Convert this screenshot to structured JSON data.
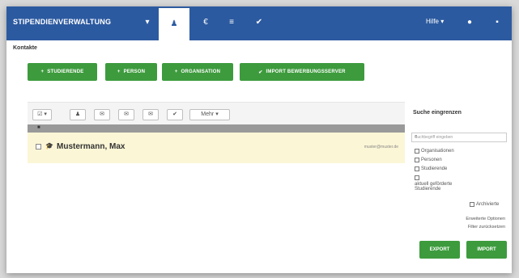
{
  "topbar": {
    "brand": "STIPENDIENVERWALTUNG",
    "nav": [
      {
        "icon": "dropdown-caret-icon",
        "glyph": "▾"
      },
      {
        "icon": "user-icon",
        "glyph": "♟"
      },
      {
        "icon": "euro-icon",
        "glyph": "€"
      },
      {
        "icon": "list-icon",
        "glyph": "≡"
      },
      {
        "icon": "check-icon",
        "glyph": "✔"
      }
    ],
    "user": "Hilfe",
    "user_caret": "▾",
    "right_icons": [
      "●",
      "▪"
    ]
  },
  "page": {
    "title": "Kontakte"
  },
  "actions": [
    {
      "label": "STUDIERENDE",
      "glyph": "+"
    },
    {
      "label": "PERSON",
      "glyph": "+"
    },
    {
      "label": "ORGANISATION",
      "glyph": "+"
    },
    {
      "label": "IMPORT BEWERBUNGSSERVER",
      "glyph": "✔"
    }
  ],
  "toolbar": {
    "select_label": "☑ ▾",
    "buttons": [
      "♟",
      "✉",
      "✉",
      "✉",
      "✔"
    ],
    "more_label": "Mehr",
    "more_caret": "▾"
  },
  "list": {
    "column_header": "■",
    "rows": [
      {
        "name": "Mustermann, Max",
        "email": "muster@muster.de"
      }
    ]
  },
  "sidebar": {
    "title": "Suche eingrenzen",
    "search_placeholder": "Suchbegriff eingeben",
    "options": [
      "Organisationen",
      "Personen",
      "Studierende",
      "aktuell geförderte Studierende"
    ],
    "archive_label": "Archivierte",
    "links": [
      "Erweiterte Optionen",
      "Filter zurücksetzen"
    ]
  },
  "bottom": {
    "export_label": "EXPORT",
    "import_label": "IMPORT"
  },
  "colors": {
    "brand_blue": "#2c5aa0",
    "action_green": "#3d9b3d",
    "highlight_row": "#fbf6d6"
  }
}
